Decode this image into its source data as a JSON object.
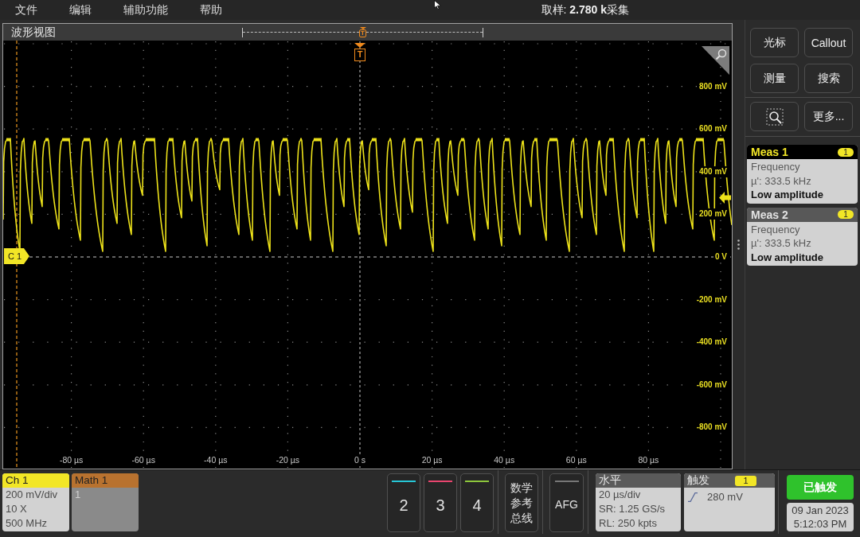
{
  "menu_bar": {
    "items": [
      "文件",
      "编辑",
      "辅助功能",
      "帮助"
    ],
    "acquisition_status": "取样: **2.780 k**采集"
  },
  "waveform_view": {
    "title": "波形视图",
    "record_marker": "T",
    "trigger_marker": "T",
    "channel_tag": "C 1",
    "y_labels": [
      "800 mV",
      "600 mV",
      "400 mV",
      "200 mV",
      "0 V",
      "-200 mV",
      "-400 mV",
      "-600 mV",
      "-800 mV"
    ],
    "x_labels": [
      "-80 µs",
      "-60 µs",
      "-40 µs",
      "-20 µs",
      "0 s",
      "20 µs",
      "40 µs",
      "60 µs",
      "80 µs"
    ]
  },
  "side_panel": {
    "buttons": [
      "光标",
      "Callout",
      "测量",
      "搜索"
    ],
    "more_button": "更多...",
    "measurements": [
      {
        "title": "Meas 1",
        "badge": "1",
        "selected": true,
        "measurement": "Frequency",
        "mean": "µ': 333.5 kHz",
        "warning": "Low amplitude"
      },
      {
        "title": "Meas 2",
        "badge": "1",
        "selected": false,
        "measurement": "Frequency",
        "mean": "µ': 333.5 kHz",
        "warning": "Low amplitude"
      }
    ]
  },
  "bottom_bar": {
    "cards": [
      {
        "kind": "channel",
        "title": "Ch 1",
        "color": "#f2e626",
        "lines": [
          "200 mV/div",
          "10 X",
          "500 MHz"
        ]
      },
      {
        "kind": "math",
        "title": "Math 1",
        "color": "#b8722f",
        "lines": [
          "1"
        ]
      }
    ],
    "channel_buttons": [
      {
        "label": "2",
        "color": "#27c6d6"
      },
      {
        "label": "3",
        "color": "#e8456e"
      },
      {
        "label": "4",
        "color": "#8dc63c"
      }
    ],
    "math_ref_bus_button": [
      "数学",
      "参考",
      "总线"
    ],
    "afg_button": "AFG",
    "horizontal": {
      "title": "水平",
      "lines": [
        "20 µs/div",
        "SR: 1.25 GS/s",
        "RL: 250 kpts"
      ]
    },
    "trigger": {
      "title": "触发",
      "badge": "1",
      "level": "280 mV"
    },
    "trigger_status": "已触发",
    "date": "09 Jan 2023",
    "time": "5:12:03 PM"
  }
}
